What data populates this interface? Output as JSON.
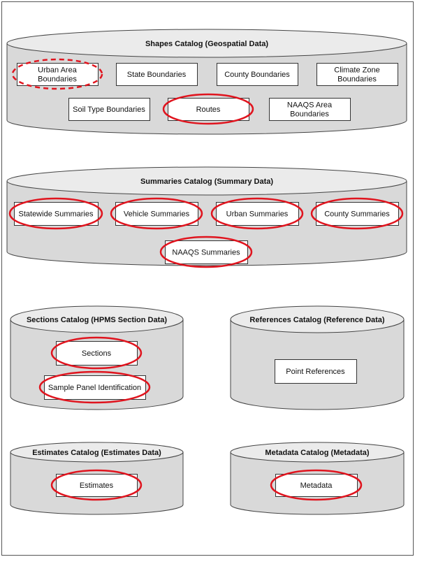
{
  "colors": {
    "cylinder_fill": "#d9d9d9",
    "cylinder_top": "#ebebeb",
    "highlight": "#e0141e",
    "box_fill": "#ffffff"
  },
  "catalogs": [
    {
      "title": "Shapes Catalog (Geospatial Data)",
      "items": [
        {
          "label": "Urban Area Boundaries",
          "lines": [
            "Urban  Area",
            "Boundaries"
          ],
          "highlight": "dashed"
        },
        {
          "label": "State Boundaries",
          "lines": [
            "State Boundaries"
          ],
          "highlight": "none"
        },
        {
          "label": "County Boundaries",
          "lines": [
            "County Boundaries"
          ],
          "highlight": "none"
        },
        {
          "label": "Climate Zone Boundaries",
          "lines": [
            "Climate Zone",
            "Boundaries"
          ],
          "highlight": "none"
        },
        {
          "label": "Soil Type Boundaries",
          "lines": [
            "Soil Type Boundaries"
          ],
          "highlight": "none"
        },
        {
          "label": "Routes",
          "lines": [
            "Routes"
          ],
          "highlight": "solid"
        },
        {
          "label": "NAAQS Area Boundaries",
          "lines": [
            "NAAQS Area",
            "Boundaries"
          ],
          "highlight": "none"
        }
      ]
    },
    {
      "title": "Summaries Catalog (Summary Data)",
      "items": [
        {
          "label": "Statewide Summaries",
          "lines": [
            "Statewide Summaries"
          ],
          "highlight": "solid"
        },
        {
          "label": "Vehicle Summaries",
          "lines": [
            "Vehicle Summaries"
          ],
          "highlight": "solid"
        },
        {
          "label": "Urban Summaries",
          "lines": [
            "Urban  Summaries"
          ],
          "highlight": "solid"
        },
        {
          "label": "County Summaries",
          "lines": [
            "County Summaries"
          ],
          "highlight": "solid"
        },
        {
          "label": "NAAQS Summaries",
          "lines": [
            "NAAQS Summaries"
          ],
          "highlight": "solid"
        }
      ]
    },
    {
      "title": "Sections Catalog (HPMS Section Data)",
      "items": [
        {
          "label": "Sections",
          "lines": [
            "Sections"
          ],
          "highlight": "solid"
        },
        {
          "label": "Sample Panel Identification",
          "lines": [
            "Sample Panel Identification"
          ],
          "highlight": "solid"
        }
      ]
    },
    {
      "title": "References Catalog (Reference Data)",
      "items": [
        {
          "label": "Point References",
          "lines": [
            "Point References"
          ],
          "highlight": "none"
        }
      ]
    },
    {
      "title": "Estimates  Catalog (Estimates  Data)",
      "items": [
        {
          "label": "Estimates",
          "lines": [
            "Estimates"
          ],
          "highlight": "solid"
        }
      ]
    },
    {
      "title": "Metadata Catalog (Metadata)",
      "items": [
        {
          "label": "Metadata",
          "lines": [
            "Metadata"
          ],
          "highlight": "solid"
        }
      ]
    }
  ]
}
